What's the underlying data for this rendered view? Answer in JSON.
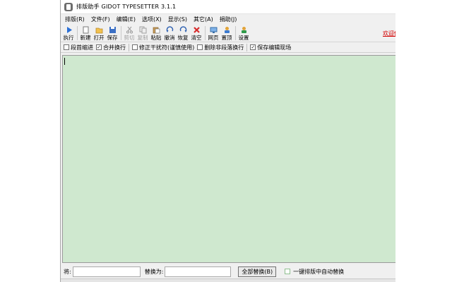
{
  "window": {
    "title": "排版助手 GIDOT TYPESETTER 3.1.1"
  },
  "menu": [
    {
      "label": "排版(R)"
    },
    {
      "label": "文件(F)"
    },
    {
      "label": "编辑(E)"
    },
    {
      "label": "选项(X)"
    },
    {
      "label": "显示(S)"
    },
    {
      "label": "其它(A)"
    },
    {
      "label": "捐助(J)"
    }
  ],
  "toolbar": {
    "buttons": [
      {
        "label": "执行",
        "icon": "play-icon",
        "enabled": true
      },
      {
        "label": "新建",
        "icon": "new-file-icon",
        "enabled": true
      },
      {
        "label": "打开",
        "icon": "open-folder-icon",
        "enabled": true
      },
      {
        "label": "保存",
        "icon": "save-icon",
        "enabled": true
      },
      {
        "label": "剪切",
        "icon": "cut-icon",
        "enabled": false
      },
      {
        "label": "复制",
        "icon": "copy-icon",
        "enabled": false
      },
      {
        "label": "粘贴",
        "icon": "paste-icon",
        "enabled": true
      },
      {
        "label": "撤消",
        "icon": "undo-icon",
        "enabled": true
      },
      {
        "label": "恢复",
        "icon": "redo-icon",
        "enabled": true
      },
      {
        "label": "清空",
        "icon": "clear-icon",
        "enabled": true
      },
      {
        "label": "网页",
        "icon": "web-icon",
        "enabled": true
      },
      {
        "label": "置顶",
        "icon": "pin-icon",
        "enabled": true
      },
      {
        "label": "设置",
        "icon": "settings-icon",
        "enabled": true
      }
    ],
    "welcome_text": "欢迎使"
  },
  "options": [
    {
      "label": "段首缩进",
      "checked": false
    },
    {
      "label": "合并换行",
      "checked": true
    },
    {
      "label": "修正干扰符(谨慎使用)",
      "checked": false
    },
    {
      "label": "删除非段落换行",
      "checked": false
    },
    {
      "label": "保存编辑现场",
      "checked": true
    }
  ],
  "editor": {
    "content": ""
  },
  "bottombar": {
    "find_label": "将:",
    "find_value": "",
    "replace_label": "替换为:",
    "replace_value": "",
    "replace_all_button": "全部替换(B)",
    "auto_replace_label": "一键排版中自动替换",
    "auto_replace_checked": false
  },
  "colors": {
    "editor_bg": "#cfe8cf",
    "accent_red": "#d40000"
  }
}
